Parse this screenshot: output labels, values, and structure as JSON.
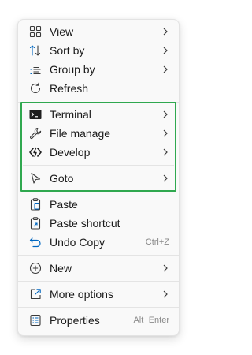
{
  "menu": {
    "items": {
      "view": {
        "label": "View",
        "icon": "grid-icon"
      },
      "sort_by": {
        "label": "Sort by",
        "icon": "sort-icon"
      },
      "group_by": {
        "label": "Group by",
        "icon": "group-list-icon"
      },
      "refresh": {
        "label": "Refresh",
        "icon": "refresh-icon"
      },
      "terminal": {
        "label": "Terminal",
        "icon": "terminal-icon"
      },
      "file_manage": {
        "label": "File manage",
        "icon": "wrench-icon"
      },
      "develop": {
        "label": "Develop",
        "icon": "develop-icon"
      },
      "goto": {
        "label": "Goto",
        "icon": "cursor-arrow-icon"
      },
      "paste": {
        "label": "Paste",
        "icon": "clipboard-icon"
      },
      "paste_shortcut": {
        "label": "Paste shortcut",
        "icon": "paste-shortcut-icon"
      },
      "undo_copy": {
        "label": "Undo Copy",
        "shortcut": "Ctrl+Z",
        "icon": "undo-icon"
      },
      "new": {
        "label": "New",
        "icon": "plus-circle-icon"
      },
      "more_options": {
        "label": "More options",
        "icon": "open-external-icon"
      },
      "properties": {
        "label": "Properties",
        "shortcut": "Alt+Enter",
        "icon": "properties-icon"
      }
    },
    "highlight_color": "#2fa84f",
    "accent_color": "#0067c0"
  }
}
